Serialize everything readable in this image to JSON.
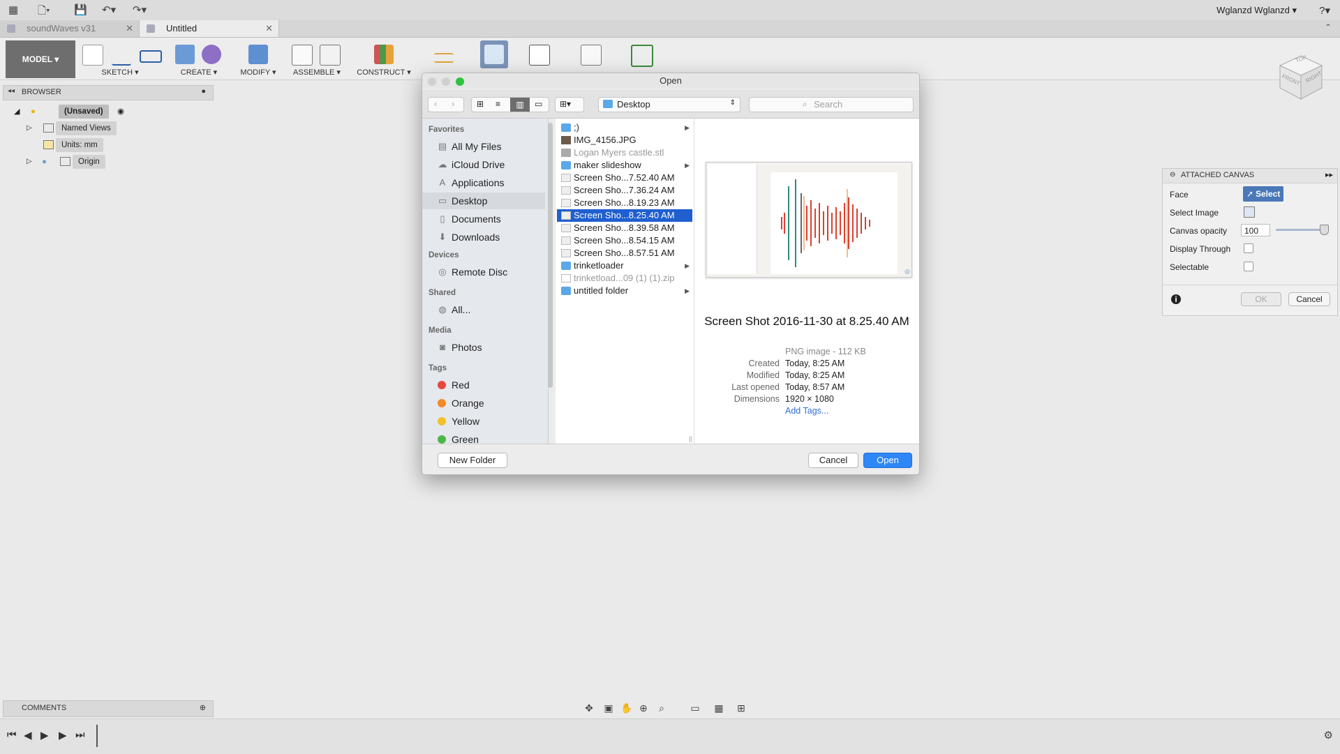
{
  "window": {
    "user": "Wglanzd Wglanzd ▾",
    "help": "?▾"
  },
  "tabs": [
    {
      "label": "soundWaves v31",
      "close": "✕"
    },
    {
      "label": "Untitled",
      "close": "✕"
    }
  ],
  "toolbar": {
    "model": "MODEL ▾",
    "groups": [
      "SKETCH ▾",
      "CREATE ▾",
      "MODIFY ▾",
      "ASSEMBLE ▾",
      "CONSTRUCT ▾"
    ]
  },
  "browser": {
    "title": "BROWSER",
    "root": "(Unsaved)",
    "items": [
      "Named Views",
      "Units: mm",
      "Origin"
    ]
  },
  "comments": {
    "title": "COMMENTS"
  },
  "dialog": {
    "title": "Open",
    "location": "Desktop",
    "search_placeholder": "Search",
    "sidebar": {
      "favorites_head": "Favorites",
      "favorites": [
        "All My Files",
        "iCloud Drive",
        "Applications",
        "Desktop",
        "Documents",
        "Downloads"
      ],
      "devices_head": "Devices",
      "devices": [
        "Remote Disc"
      ],
      "shared_head": "Shared",
      "shared": [
        "All..."
      ],
      "media_head": "Media",
      "media": [
        "Photos"
      ],
      "tags_head": "Tags",
      "tags": [
        {
          "name": "Red",
          "color": "#e5483c"
        },
        {
          "name": "Orange",
          "color": "#f08a24"
        },
        {
          "name": "Yellow",
          "color": "#f2c029"
        },
        {
          "name": "Green",
          "color": "#4cb748"
        }
      ]
    },
    "files": [
      {
        "name": ";)",
        "kind": "folder",
        "arrow": "▶"
      },
      {
        "name": "IMG_4156.JPG",
        "kind": "image"
      },
      {
        "name": "Logan Myers castle.stl",
        "kind": "file-dim"
      },
      {
        "name": "maker slideshow",
        "kind": "folder",
        "arrow": "▶"
      },
      {
        "name": "Screen Sho...7.52.40 AM",
        "kind": "png"
      },
      {
        "name": "Screen Sho...7.36.24 AM",
        "kind": "png"
      },
      {
        "name": "Screen Sho...8.19.23 AM",
        "kind": "png"
      },
      {
        "name": "Screen Sho...8.25.40 AM",
        "kind": "png",
        "selected": true
      },
      {
        "name": "Screen Sho...8.39.58 AM",
        "kind": "png"
      },
      {
        "name": "Screen Sho...8.54.15 AM",
        "kind": "png"
      },
      {
        "name": "Screen Sho...8.57.51 AM",
        "kind": "png"
      },
      {
        "name": "trinketloader",
        "kind": "folder",
        "arrow": "▶"
      },
      {
        "name": "trinketload...09 (1) (1).zip",
        "kind": "file-dim"
      },
      {
        "name": "untitled folder",
        "kind": "folder",
        "arrow": "▶"
      }
    ],
    "preview": {
      "title": "Screen Shot 2016-11-30 at 8.25.40 AM",
      "kind": "PNG image - 112 KB",
      "meta": [
        {
          "key": "Created",
          "value": "Today, 8:25 AM"
        },
        {
          "key": "Modified",
          "value": "Today, 8:25 AM"
        },
        {
          "key": "Last opened",
          "value": "Today, 8:57 AM"
        },
        {
          "key": "Dimensions",
          "value": "1920 × 1080"
        }
      ],
      "add_tags": "Add Tags..."
    },
    "new_folder": "New Folder",
    "cancel": "Cancel",
    "open": "Open"
  },
  "attached_canvas": {
    "title": "ATTACHED CANVAS",
    "face_label": "Face",
    "face_button": "Select",
    "select_image_label": "Select Image",
    "opacity_label": "Canvas opacity",
    "opacity_value": "100",
    "display_through_label": "Display Through",
    "selectable_label": "Selectable",
    "ok": "OK",
    "cancel": "Cancel"
  },
  "viewcube": {
    "top": "TOP",
    "front": "FRONT",
    "right": "RIGHT"
  },
  "colors": {
    "accent": "#2f6fd6",
    "selection": "#1f5fcf",
    "chrome": "#e2e2e2"
  }
}
